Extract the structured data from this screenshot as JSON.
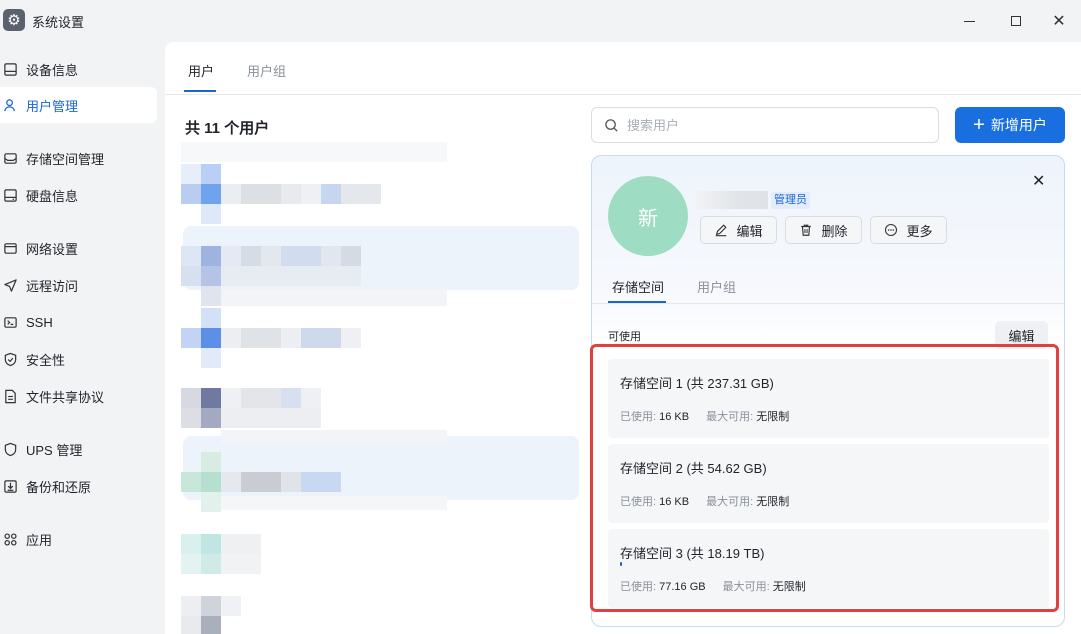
{
  "window": {
    "title": "系统设置"
  },
  "sidebar": {
    "items": [
      {
        "label": "设备信息",
        "icon": "device-icon"
      },
      {
        "label": "用户管理",
        "icon": "user-icon",
        "active": true
      },
      {
        "label": "存储空间管理",
        "icon": "storage-icon"
      },
      {
        "label": "硬盘信息",
        "icon": "disk-icon"
      },
      {
        "label": "网络设置",
        "icon": "network-icon"
      },
      {
        "label": "远程访问",
        "icon": "send-icon"
      },
      {
        "label": "SSH",
        "icon": "terminal-icon"
      },
      {
        "label": "安全性",
        "icon": "shield-check-icon"
      },
      {
        "label": "文件共享协议",
        "icon": "file-icon"
      },
      {
        "label": "UPS 管理",
        "icon": "shield-icon"
      },
      {
        "label": "备份和还原",
        "icon": "backup-icon"
      },
      {
        "label": "应用",
        "icon": "apps-icon"
      }
    ]
  },
  "tabs": [
    {
      "label": "用户",
      "active": true
    },
    {
      "label": "用户组"
    }
  ],
  "user_count": "共 11 个用户",
  "search": {
    "placeholder": "搜索用户"
  },
  "add_button": {
    "label": "新增用户"
  },
  "detail": {
    "avatar_text": "新",
    "role_badge": "管理员",
    "actions": {
      "edit": "编辑",
      "delete": "删除",
      "more": "更多"
    },
    "tabs": [
      {
        "label": "存储空间",
        "active": true
      },
      {
        "label": "用户组"
      }
    ],
    "available_label": "可使用",
    "edit_label": "编辑",
    "used_label": "已使用:",
    "max_label": "最大可用:",
    "storages": [
      {
        "title": "存储空间 1 (共 237.31 GB)",
        "used": "16 KB",
        "max": "无限制",
        "used_fraction": 0
      },
      {
        "title": "存储空间 2 (共 54.62 GB)",
        "used": "16 KB",
        "max": "无限制",
        "used_fraction": 0
      },
      {
        "title": "存储空间 3 (共 18.19 TB)",
        "used": "77.16 GB",
        "max": "无限制",
        "used_fraction": 0.004
      }
    ]
  },
  "colors": {
    "accent": "#1766d6",
    "highlight": "#e2403f",
    "avatar": "#9fdcc4"
  }
}
